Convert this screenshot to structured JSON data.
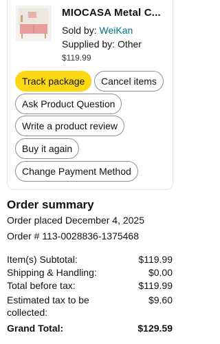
{
  "product": {
    "title": "MIOCASA Metal C...",
    "sold_by_label": "Sold by: ",
    "seller_name": "WeiKan",
    "supplied_by": "Supplied by: Other",
    "price": "$119.99"
  },
  "actions": {
    "track_package": "Track package",
    "cancel_items": "Cancel items",
    "ask_question": "Ask Product Question",
    "write_review": "Write a product review",
    "buy_again": "Buy it again",
    "change_payment": "Change Payment Method"
  },
  "order_summary": {
    "heading": "Order summary",
    "order_placed_label": "Order placed",
    "order_placed_date": "December 4, 2025",
    "order_number_label": "Order #",
    "order_number": "113-0028836-1375468",
    "lines": [
      {
        "label": "Item(s) Subtotal:",
        "value": "$119.99"
      },
      {
        "label": "Shipping & Handling:",
        "value": "$0.00"
      },
      {
        "label": "Total before tax:",
        "value": "$119.99"
      },
      {
        "label": "Estimated tax to be",
        "label2": "collected:",
        "value": "$9.60"
      },
      {
        "label": "Grand Total:",
        "value": "$129.59"
      }
    ]
  },
  "colors": {
    "primary_button": "#ffd814",
    "link": "#007185"
  }
}
